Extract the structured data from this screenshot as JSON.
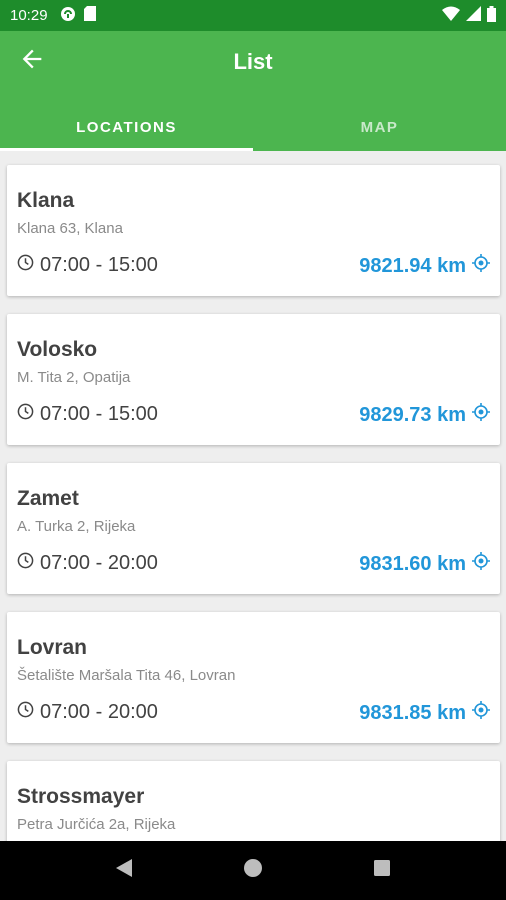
{
  "status_bar": {
    "time": "10:29",
    "left_icons": [
      "cloud-sync-icon",
      "sd-card-icon"
    ],
    "right_icons": [
      "wifi-icon",
      "signal-icon",
      "battery-icon"
    ],
    "color": "#1e8c2b"
  },
  "app_bar": {
    "title": "List",
    "back_icon": "arrow-back-icon",
    "color": "#4cb54f"
  },
  "tabs": [
    {
      "label": "LOCATIONS",
      "selected": true
    },
    {
      "label": "MAP",
      "selected": false
    }
  ],
  "locations": [
    {
      "name": "Klana",
      "address": "Klana 63, Klana",
      "hours": "07:00 - 15:00",
      "distance": "9821.94 km"
    },
    {
      "name": "Volosko",
      "address": "M. Tita 2, Opatija",
      "hours": "07:00 - 15:00",
      "distance": "9829.73 km"
    },
    {
      "name": "Zamet",
      "address": "A. Turka 2, Rijeka",
      "hours": "07:00 - 20:00",
      "distance": "9831.60 km"
    },
    {
      "name": "Lovran",
      "address": "Šetalište Maršala Tita 46, Lovran",
      "hours": "07:00 - 20:00",
      "distance": "9831.85 km"
    },
    {
      "name": "Strossmayer",
      "address": "Petra Jurčića 2a, Rijeka",
      "hours": "",
      "distance": ""
    }
  ],
  "accent_color": "#2196d9",
  "nav_bar": {
    "buttons": [
      "back-triangle-icon",
      "home-circle-icon",
      "recents-square-icon"
    ]
  }
}
